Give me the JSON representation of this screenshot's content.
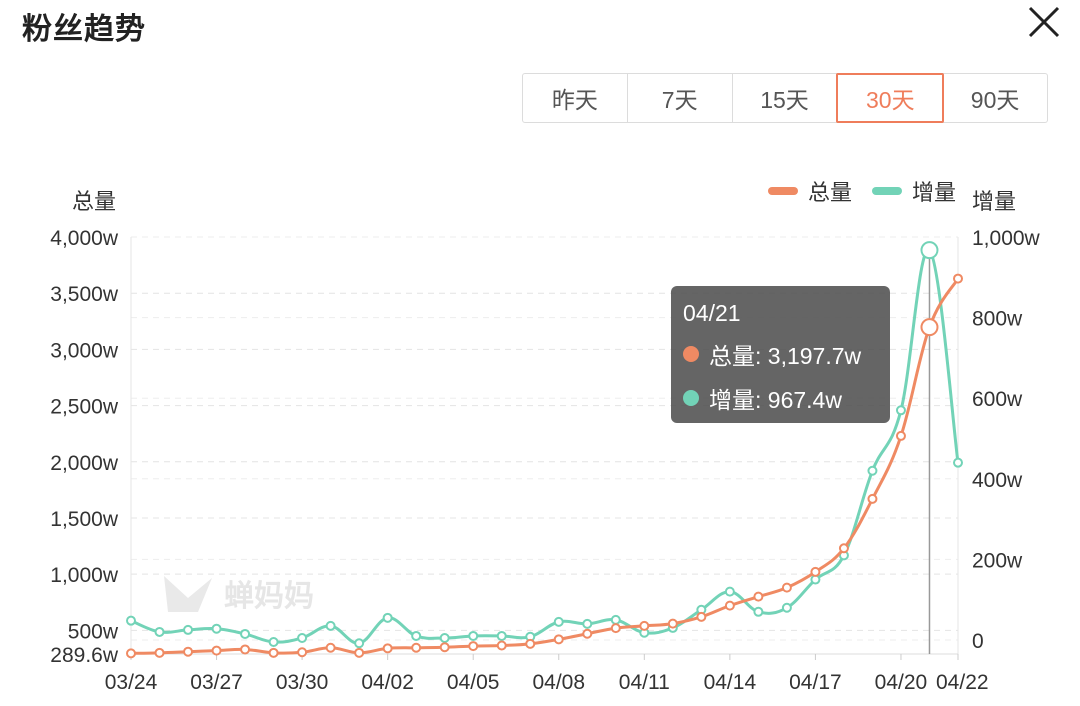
{
  "header": {
    "title": "粉丝趋势"
  },
  "range_tabs": [
    {
      "label": "昨天",
      "active": false
    },
    {
      "label": "7天",
      "active": false
    },
    {
      "label": "15天",
      "active": false
    },
    {
      "label": "30天",
      "active": true
    },
    {
      "label": "90天",
      "active": false
    }
  ],
  "colors": {
    "total": "#ef8a63",
    "increase": "#72d3b7",
    "accent": "#ef7d5b"
  },
  "watermark": {
    "text": "蝉妈妈"
  },
  "tooltip": {
    "date": "04/21",
    "total_label": "总量: 3,197.7w",
    "increase_label": "增量: 967.4w"
  },
  "chart_data": {
    "type": "line",
    "title": "",
    "left_axis_label": "总量",
    "right_axis_label": "增量",
    "left_ticks": [
      "289.6w",
      "500w",
      "1,000w",
      "1,500w",
      "2,000w",
      "2,500w",
      "3,000w",
      "3,500w",
      "4,000w"
    ],
    "right_ticks": [
      "0",
      "200w",
      "400w",
      "600w",
      "800w",
      "1,000w"
    ],
    "left_ylim": [
      289.6,
      4000
    ],
    "right_ylim": [
      0,
      1000
    ],
    "x_tick_labels": [
      "03/24",
      "03/27",
      "03/30",
      "04/02",
      "04/05",
      "04/08",
      "04/11",
      "04/14",
      "04/17",
      "04/20",
      "04/22"
    ],
    "x": [
      "03/24",
      "03/25",
      "03/26",
      "03/27",
      "03/28",
      "03/29",
      "03/30",
      "03/31",
      "04/01",
      "04/02",
      "04/03",
      "04/04",
      "04/05",
      "04/06",
      "04/07",
      "04/08",
      "04/09",
      "04/10",
      "04/11",
      "04/12",
      "04/13",
      "04/14",
      "04/15",
      "04/16",
      "04/17",
      "04/18",
      "04/19",
      "04/20",
      "04/21",
      "04/22"
    ],
    "legend_position": "top-right",
    "grid": true,
    "series": [
      {
        "name": "总量",
        "axis": "left",
        "values": [
          295,
          300,
          310,
          320,
          330,
          300,
          305,
          345,
          300,
          340,
          345,
          350,
          360,
          365,
          380,
          420,
          470,
          520,
          540,
          560,
          620,
          720,
          800,
          880,
          1020,
          1230,
          1670,
          2230,
          3197.7,
          3630
        ]
      },
      {
        "name": "增量",
        "axis": "right",
        "values": [
          48,
          20,
          25,
          28,
          15,
          -5,
          5,
          35,
          -8,
          55,
          10,
          5,
          10,
          10,
          8,
          45,
          40,
          50,
          18,
          30,
          75,
          120,
          70,
          80,
          150,
          210,
          420,
          570,
          967.4,
          440
        ]
      }
    ],
    "highlight_index": 28
  }
}
